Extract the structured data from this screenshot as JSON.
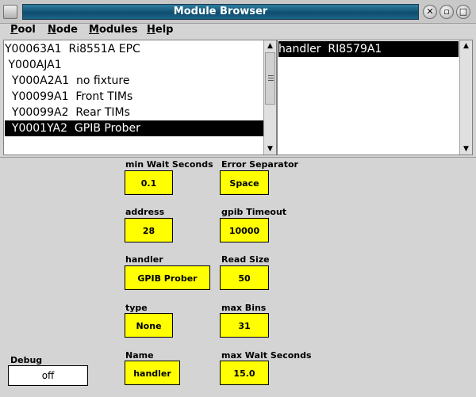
{
  "window": {
    "title": "Module Browser"
  },
  "menu": {
    "items": [
      {
        "first": "P",
        "rest": "ool"
      },
      {
        "first": "N",
        "rest": "ode"
      },
      {
        "first": "M",
        "rest": "odules"
      },
      {
        "first": "H",
        "rest": "elp"
      }
    ]
  },
  "tree": {
    "rows": [
      {
        "text": "Y00063A1  Ri8551A EPC",
        "selected": false
      },
      {
        "text": " Y000AJA1",
        "selected": false
      },
      {
        "text": "  Y000A2A1  no fixture",
        "selected": false
      },
      {
        "text": "  Y00099A1  Front TIMs",
        "selected": false
      },
      {
        "text": "  Y00099A2  Rear TIMs",
        "selected": false
      },
      {
        "text": "  Y0001YA2  GPIB Prober",
        "selected": true
      }
    ]
  },
  "modules_list": {
    "rows": [
      {
        "text": "handler  RI8579A1",
        "selected": true
      }
    ]
  },
  "fields": {
    "min_wait": {
      "label": "min Wait Seconds",
      "value": "0.1"
    },
    "error_sep": {
      "label": "Error Separator",
      "value": "Space"
    },
    "address": {
      "label": "address",
      "value": "28"
    },
    "gpib_timeout": {
      "label": "gpib Timeout",
      "value": "10000"
    },
    "handler": {
      "label": "handler",
      "value": "GPIB Prober"
    },
    "read_size": {
      "label": "Read Size",
      "value": "50"
    },
    "type": {
      "label": "type",
      "value": "None"
    },
    "max_bins": {
      "label": "max Bins",
      "value": "31"
    },
    "name": {
      "label": "Name",
      "value": "handler"
    },
    "max_wait": {
      "label": "max Wait Seconds",
      "value": "15.0"
    }
  },
  "debug": {
    "label": "Debug",
    "value": "off"
  },
  "colors": {
    "field_bg": "#ffff00",
    "title_bar": "#0e4e70",
    "selection": "#000000"
  },
  "icons": {
    "close": "close-icon",
    "minimize": "minimize-icon",
    "maximize": "maximize-icon"
  }
}
